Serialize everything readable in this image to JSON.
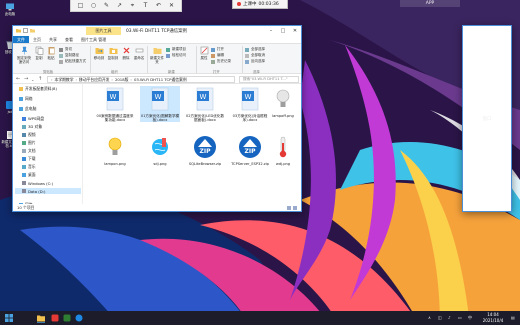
{
  "recording": {
    "prefix": "上课中",
    "time": "00:03:36"
  },
  "top_tabs": {
    "app": "APP",
    "window": "窗口"
  },
  "desktop_icons": [
    {
      "label": "此电脑"
    },
    {
      "label": "回收站"
    },
    {
      "label": "jsd"
    },
    {
      "label": "新建文本文档.txt"
    }
  ],
  "explorer": {
    "title": "03.Wi-Fi DHT11 TCP通信案例",
    "context_tab": "图片工具",
    "tabs": [
      "文件",
      "主页",
      "共享",
      "查看",
      "图片工具 管理"
    ],
    "ribbon": {
      "pin": "固定到快速访问",
      "copy": "复制",
      "paste": "粘贴",
      "cut": "剪切",
      "copy_path": "复制路径",
      "paste_shortcut": "粘贴快捷方式",
      "move_to": "移动到",
      "copy_to": "复制到",
      "delete": "删除",
      "rename": "重命名",
      "new_folder": "新建文件夹",
      "new_item": "新建项目",
      "easy_access": "轻松访问",
      "properties": "属性",
      "open": "打开",
      "edit": "编辑",
      "history": "历史记录",
      "select_all": "全部选择",
      "select_none": "全部取消",
      "invert": "反向选择",
      "groups": [
        "剪贴板",
        "组织",
        "新建",
        "打开",
        "选择"
      ]
    },
    "address": {
      "segments": [
        "本学期教学",
        "移动平台应用开发",
        "2018版",
        "03.Wi-Fi DHT11 TCP通信案例"
      ],
      "search_placeholder": "搜索\"03.Wi-Fi DHT11 T...\""
    },
    "nav": [
      {
        "label": "开发板配套资料(8)"
      },
      {
        "label": "网络"
      },
      {
        "label": "此电脑"
      },
      {
        "label": "WPS网盘"
      },
      {
        "label": "3D 对象"
      },
      {
        "label": "视频"
      },
      {
        "label": "图片"
      },
      {
        "label": "文档"
      },
      {
        "label": "下载"
      },
      {
        "label": "音乐"
      },
      {
        "label": "桌面"
      },
      {
        "label": "Windows (C:)"
      },
      {
        "label": "Data (D:)"
      },
      {
        "label": "网络"
      }
    ],
    "files": [
      {
        "name": "00案例数据通过温度采集功能.docx",
        "icon": "word-icon"
      },
      {
        "name": "01方案优化(图解数学模板).docx",
        "icon": "word-icon"
      },
      {
        "name": "02方案优化(LED优化数据面板).docx",
        "icon": "word-icon"
      },
      {
        "name": "03方案优化(对话框程序).docx",
        "icon": "word-icon"
      },
      {
        "name": "lampoff.png",
        "icon": "bulb-off-icon"
      },
      {
        "name": "lampon.png",
        "icon": "bulb-on-icon"
      },
      {
        "name": "sdj.png",
        "icon": "globe-icon"
      },
      {
        "name": "SQLiteBrowser.zip",
        "icon": "zip-icon"
      },
      {
        "name": "TCPServer_ESP32.zip",
        "icon": "zip-icon"
      },
      {
        "name": "wdj.png",
        "icon": "thermometer-icon"
      }
    ],
    "status": "10 个项目"
  },
  "taskbar": {
    "time": "14:04",
    "date": "2021/10/4",
    "lang": "中"
  }
}
